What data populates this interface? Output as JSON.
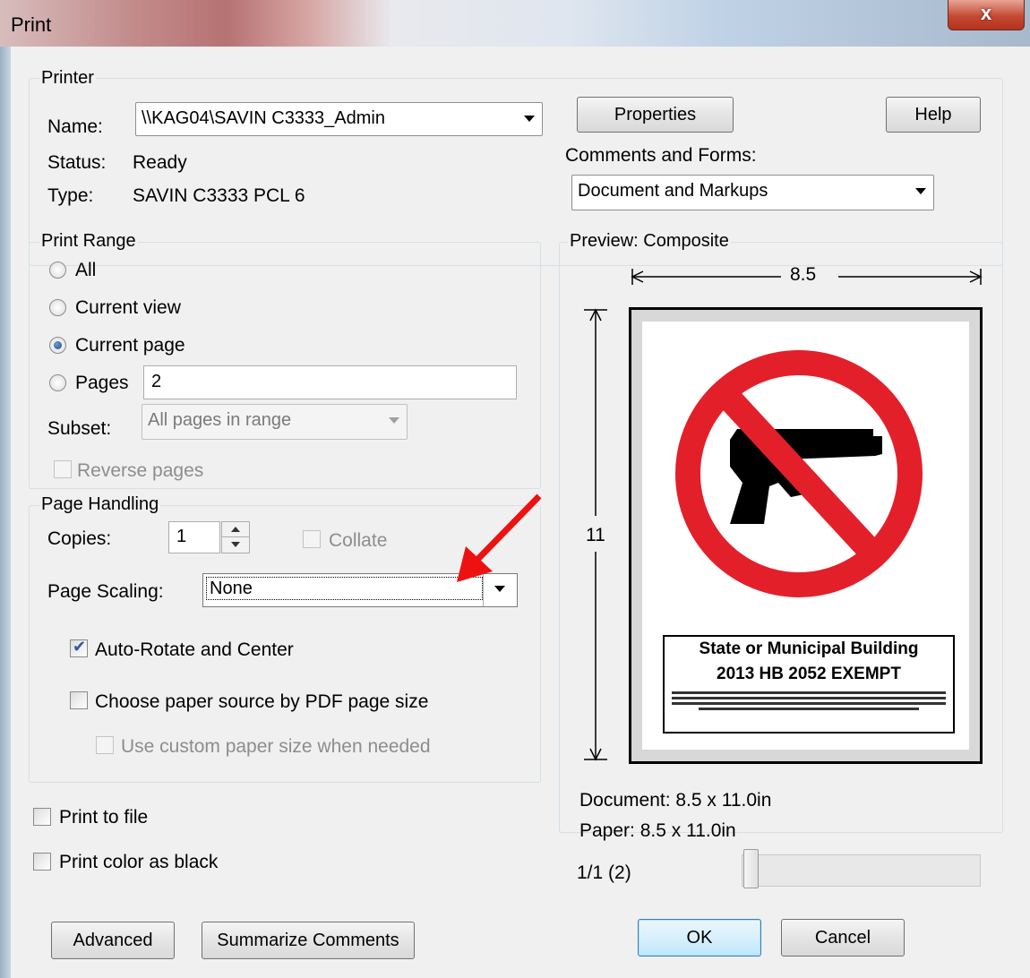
{
  "window": {
    "title": "Print",
    "close_label": "x"
  },
  "printer": {
    "group_label": "Printer",
    "name_label": "Name:",
    "name_value": "\\\\KAG04\\SAVIN C3333_Admin",
    "status_label": "Status:",
    "status_value": "Ready",
    "type_label": "Type:",
    "type_value": "SAVIN C3333 PCL 6",
    "properties_button": "Properties",
    "help_button": "Help",
    "comments_label": "Comments and Forms:",
    "comments_value": "Document and Markups"
  },
  "print_range": {
    "group_label": "Print Range",
    "all_label": "All",
    "current_view_label": "Current view",
    "current_page_label": "Current page",
    "pages_label": "Pages",
    "pages_value": "2",
    "selected": "Current page",
    "subset_label": "Subset:",
    "subset_value": "All pages in range",
    "reverse_label": "Reverse pages"
  },
  "page_handling": {
    "group_label": "Page Handling",
    "copies_label": "Copies:",
    "copies_value": "1",
    "collate_label": "Collate",
    "scaling_label": "Page Scaling:",
    "scaling_value": "None",
    "auto_rotate_label": "Auto-Rotate and Center",
    "auto_rotate_checked": true,
    "paper_source_label": "Choose paper source by PDF page size",
    "custom_paper_label": "Use custom paper size when needed"
  },
  "options": {
    "print_to_file_label": "Print to file",
    "print_color_black_label": "Print color as black"
  },
  "preview": {
    "group_label": "Preview: Composite",
    "width_label": "8.5",
    "height_label": "11",
    "sign_line1": "State or Municipal Building",
    "sign_line2": "2013 HB 2052 EXEMPT",
    "document_label": "Document: 8.5 x 11.0in",
    "paper_label": "Paper: 8.5 x 11.0in",
    "page_counter": "1/1 (2)"
  },
  "buttons": {
    "advanced": "Advanced",
    "summarize": "Summarize Comments",
    "ok": "OK",
    "cancel": "Cancel"
  },
  "colors": {
    "annotation_arrow": "#ee1111",
    "prohibition_red": "#e3202a"
  }
}
